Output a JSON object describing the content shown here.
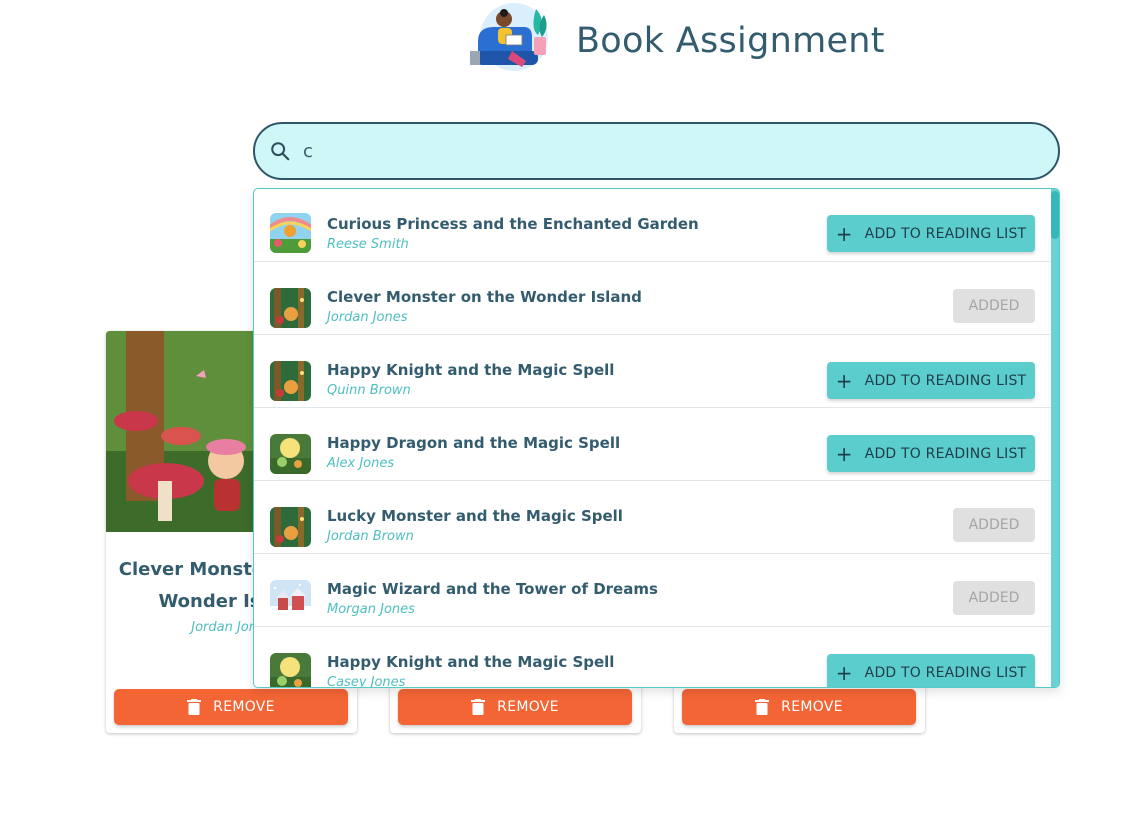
{
  "app": {
    "title": "Book Assignment"
  },
  "search": {
    "value": "c",
    "icon": "search-icon"
  },
  "dropdown": {
    "results": [
      {
        "title": "Curious Princess and the Enchanted Garden",
        "author": "Reese Smith",
        "status": "add",
        "button_label": "ADD TO READING LIST"
      },
      {
        "title": "Clever Monster on the Wonder Island",
        "author": "Jordan Jones",
        "status": "added",
        "button_label": "ADDED"
      },
      {
        "title": "Happy Knight and the Magic Spell",
        "author": "Quinn Brown",
        "status": "add",
        "button_label": "ADD TO READING LIST"
      },
      {
        "title": "Happy Dragon and the Magic Spell",
        "author": "Alex Jones",
        "status": "add",
        "button_label": "ADD TO READING LIST"
      },
      {
        "title": "Lucky Monster and the Magic Spell",
        "author": "Jordan Brown",
        "status": "added",
        "button_label": "ADDED"
      },
      {
        "title": "Magic Wizard and the Tower of Dreams",
        "author": "Morgan Jones",
        "status": "added",
        "button_label": "ADDED"
      },
      {
        "title": "Happy Knight and the Magic Spell",
        "author": "Casey Jones",
        "status": "add",
        "button_label": "ADD TO READING LIST"
      }
    ]
  },
  "reading_list": {
    "cards": [
      {
        "title_line1": "Clever Monster on the",
        "title_line2": "Wonder Island",
        "author": "Jordan Jones",
        "remove_label": "REMOVE"
      },
      {
        "remove_label": "REMOVE"
      },
      {
        "remove_label": "REMOVE"
      }
    ]
  },
  "colors": {
    "primary": "#5ccdcd",
    "danger": "#f46535",
    "text": "#335c6e",
    "author": "#4fbfc1",
    "search_bg": "#cff7f7"
  }
}
